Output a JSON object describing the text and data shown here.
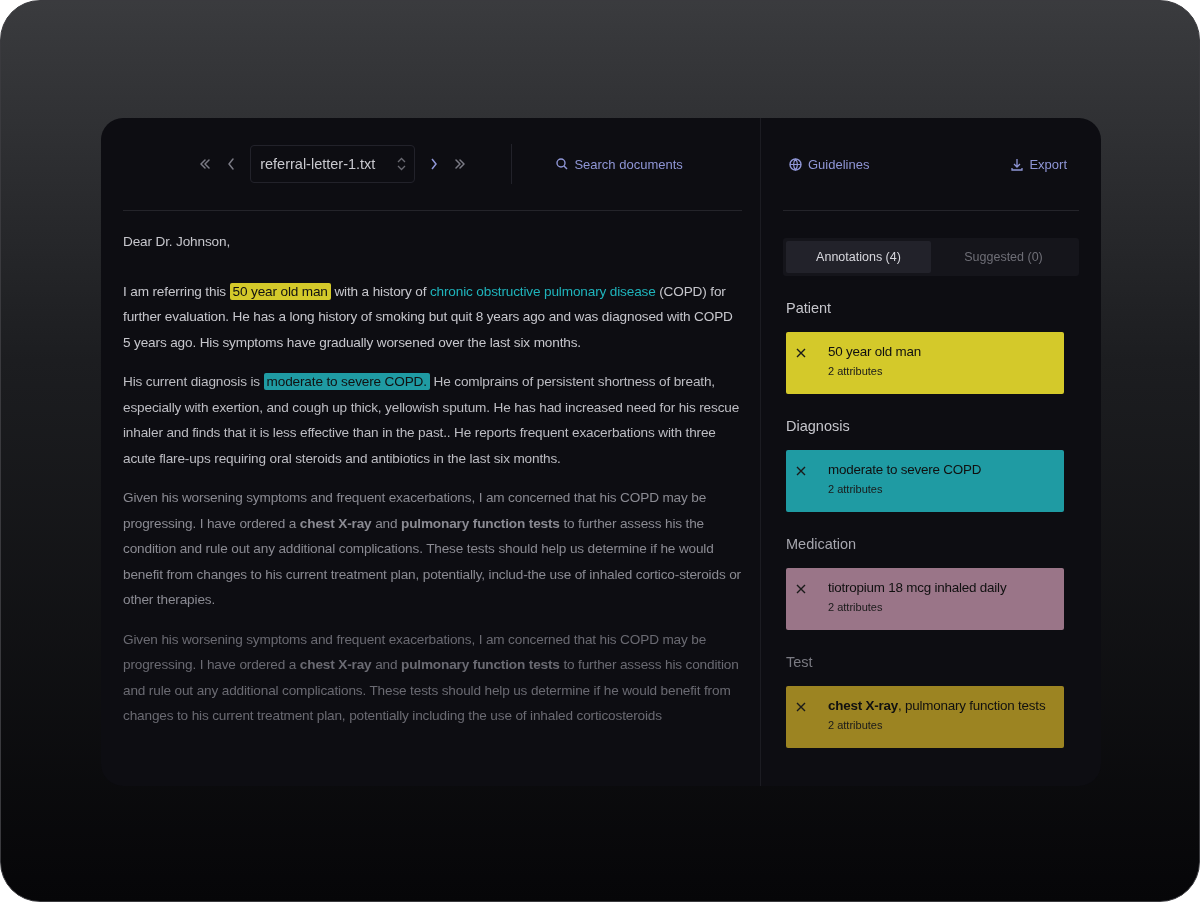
{
  "toolbar": {
    "file_select": {
      "value": "referral-letter-1.txt"
    },
    "search": {
      "label": "Search documents"
    }
  },
  "document": {
    "paragraphs": [
      {
        "segments": [
          {
            "kind": "plain",
            "text": "Dear Dr. Johnson,"
          }
        ]
      },
      {
        "segments": [
          {
            "kind": "plain",
            "text": "I am referring this "
          },
          {
            "kind": "highlight",
            "text": "50 year old man",
            "color": "#d4c92a"
          },
          {
            "kind": "plain",
            "text": " with a history of "
          },
          {
            "kind": "link",
            "text": "chronic obstructive pulmonary disease"
          },
          {
            "kind": "plain",
            "text": " (COPD) for further evaluation. He has a long history of smoking but quit 8 years ago and was diagnosed with COPD 5 years ago. His symptoms have gradually worsened over the last six months."
          }
        ]
      },
      {
        "segments": [
          {
            "kind": "plain",
            "text": "His current diagnosis is "
          },
          {
            "kind": "highlight",
            "text": "moderate to severe COPD.",
            "color": "#1f9ba3"
          },
          {
            "kind": "plain",
            "text": " He comlprains of persistent shortness of breath, especially with exertion, and cough up thick, yellowish sputum. He has had increased need for his rescue inhaler and finds that it is less effective than in the past.. He reports frequent exacerbations with three acute flare-ups requiring oral steroids and antibiotics in the last six months."
          }
        ]
      },
      {
        "segments": [
          {
            "kind": "plain",
            "text": "Given his worsening symptoms and frequent exacerbations, I am concerned that his COPD may be progressing. I have ordered a **chest X-ray** and **pulmonary function tests** to further assess his the condition and rule out any additional complications. These tests should help us determine if he would benefit from changes to his current treatment plan, potentially, includ-the use of inhaled cortico-steroids or other therapies."
          }
        ]
      },
      {
        "segments": [
          {
            "kind": "plain",
            "text": "Given his worsening symptoms and frequent exacerbations, I am concerned that his COPD may be progressing. I have ordered a **chest X-ray** and **pulmonary function tests** to further assess his condition and rule out any additional complications. These tests should help us determine if he would benefit from changes to his current treatment plan, potentially including the use of inhaled corticosteroids"
          }
        ]
      }
    ]
  },
  "sidebar": {
    "links": [
      {
        "kind": "guidelines",
        "label": "Guidelines"
      },
      {
        "kind": "export",
        "label": "Export"
      }
    ],
    "tabs": [
      {
        "label": "Annotations (4)",
        "selected": true
      },
      {
        "label": "Suggested (0)",
        "selected": false
      }
    ],
    "groups": [
      {
        "label": "Patient",
        "card": {
          "title": "50 year old man",
          "subtitle": "2 attributes",
          "color": "#d4c92a"
        }
      },
      {
        "label": "Diagnosis",
        "card": {
          "title": "moderate to severe COPD",
          "subtitle": "2 attributes",
          "color": "#1f9ba3"
        }
      },
      {
        "label": "Medication",
        "card": {
          "title": "tiotropium 18 mcg inhaled daily",
          "subtitle": "2 attributes",
          "color": "#9a7588"
        }
      },
      {
        "label": "Test",
        "card": {
          "title": "**chest X-ray**, pulmonary function tests",
          "subtitle": "2 attributes",
          "color": "#9c8422"
        }
      }
    ]
  }
}
